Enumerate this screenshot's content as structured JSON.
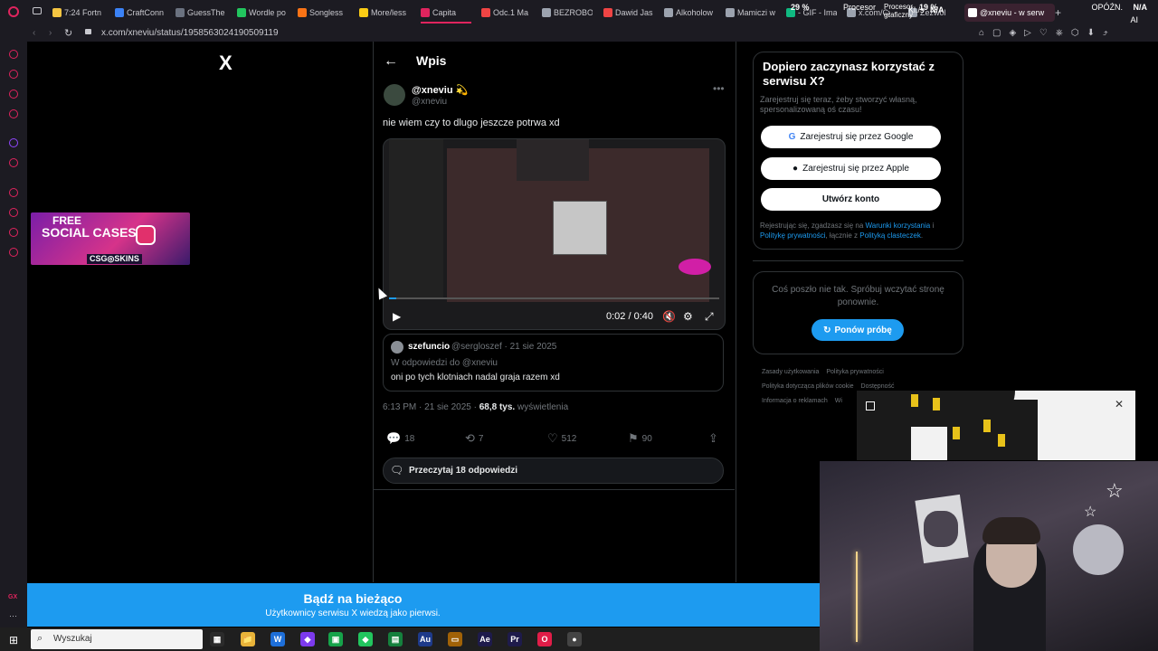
{
  "browser": {
    "tabs": [
      {
        "label": "7:24 Fortn",
        "color": "#f5c542"
      },
      {
        "label": "CraftConn",
        "color": "#3b82f6"
      },
      {
        "label": "GuessThe",
        "color": "#6b7280"
      },
      {
        "label": "Wordle po",
        "color": "#22c55e"
      },
      {
        "label": "Songless",
        "color": "#f97316"
      },
      {
        "label": "More/less",
        "color": "#facc15"
      },
      {
        "label": "Capita",
        "color": "#e0245e"
      },
      {
        "label": "Odc.1 Ma",
        "color": "#ef4444"
      },
      {
        "label": "BEZROBO",
        "color": "#9ca3af"
      },
      {
        "label": "Dawid Jas",
        "color": "#ef4444"
      },
      {
        "label": "Alkoholow",
        "color": "#9ca3af"
      },
      {
        "label": "Mamiczi w",
        "color": "#9ca3af"
      },
      {
        "label": "- GIF - Ima",
        "color": "#10b981"
      },
      {
        "label": "x.com/Cyf",
        "color": "#9ca3af"
      },
      {
        "label": "Zezwól",
        "color": "#9ca3af"
      },
      {
        "label": "@xneviu - w serw",
        "color": "#ffffff"
      }
    ],
    "url": "x.com/xneviu/status/1958563024190509119",
    "sys": {
      "kls_label": "Kl./s",
      "kls_value": "N/A",
      "cpu_pct": "29 %",
      "cpu_label": "Procesor",
      "gpu_label": "Procesor graficzny",
      "gpu_pct": "19 %",
      "lag_label": "OPÓŹN.",
      "lag_value": "N/A",
      "ai": "AI"
    }
  },
  "x": {
    "logo": "X",
    "header_back": "←",
    "header_title": "Wpis",
    "tweet": {
      "name": "@xneviu 💫",
      "handle": "@xneviu",
      "text": "nie wiem czy to dlugo jeszcze potrwa xd",
      "video_time": "0:02 / 0:40",
      "quote": {
        "name": "szefuncio",
        "meta": "@sergloszef · 21 sie 2025",
        "reply_to": "W odpowiedzi do @xneviu",
        "text": "oni po tych klotniach nadal graja razem xd"
      },
      "time": "6:13 PM · 21 sie 2025 · ",
      "views_num": "68,8 tys.",
      "views_label": " wyświetlenia",
      "replies": "18",
      "reposts": "7",
      "likes": "512",
      "bookmarks": "90",
      "read_replies": "Przeczytaj 18 odpowiedzi"
    },
    "signup": {
      "title": "Dopiero zaczynasz korzystać z serwisu X?",
      "subtitle": "Zarejestruj się teraz, żeby stworzyć własną, spersonalizowaną oś czasu!",
      "google": "Zarejestruj się przez Google",
      "apple": "Zarejestruj się przez Apple",
      "create": "Utwórz konto",
      "legal_1": "Rejestrując się, zgadzasz się na ",
      "terms": "Warunki korzystania",
      "legal_2": " i ",
      "privacy": "Politykę prywatności",
      "legal_3": ", łącznie z ",
      "cookies": "Polityką clasteczek",
      "legal_4": "."
    },
    "error": {
      "text": "Coś poszło nie tak. Spróbuj wczytać stronę ponownie.",
      "retry": "Ponów próbę"
    },
    "footer": [
      "Zasady użytkowania",
      "Polityka prywatności",
      "Polityka dotycząca plików cookie",
      "Dostępność",
      "Informacja o reklamach",
      "Wi"
    ],
    "banner": {
      "title": "Bądź na bieżąco",
      "subtitle": "Użytkownicy serwisu X wiedzą jako pierwsi."
    }
  },
  "ad": {
    "line1": "FREE",
    "line2": "SOCIAL CASES",
    "brand": "CSG◎SKINS"
  },
  "taskbar": {
    "search": "Wyszukaj",
    "apps": [
      {
        "label": "▦",
        "color": "#2b2b2b"
      },
      {
        "label": "📁",
        "color": "#e8b339"
      },
      {
        "label": "W",
        "color": "#1e6fd9"
      },
      {
        "label": "◆",
        "color": "#7c3aed"
      },
      {
        "label": "▣",
        "color": "#16a34a"
      },
      {
        "label": "◆",
        "color": "#22c55e"
      },
      {
        "label": "▤",
        "color": "#15803d"
      },
      {
        "label": "Au",
        "color": "#1e3a8a"
      },
      {
        "label": "▭",
        "color": "#a16207"
      },
      {
        "label": "Ae",
        "color": "#1e1b4b"
      },
      {
        "label": "Pr",
        "color": "#1e1b4b"
      },
      {
        "label": "O",
        "color": "#e11d48"
      },
      {
        "label": "●",
        "color": "#444444"
      }
    ]
  }
}
